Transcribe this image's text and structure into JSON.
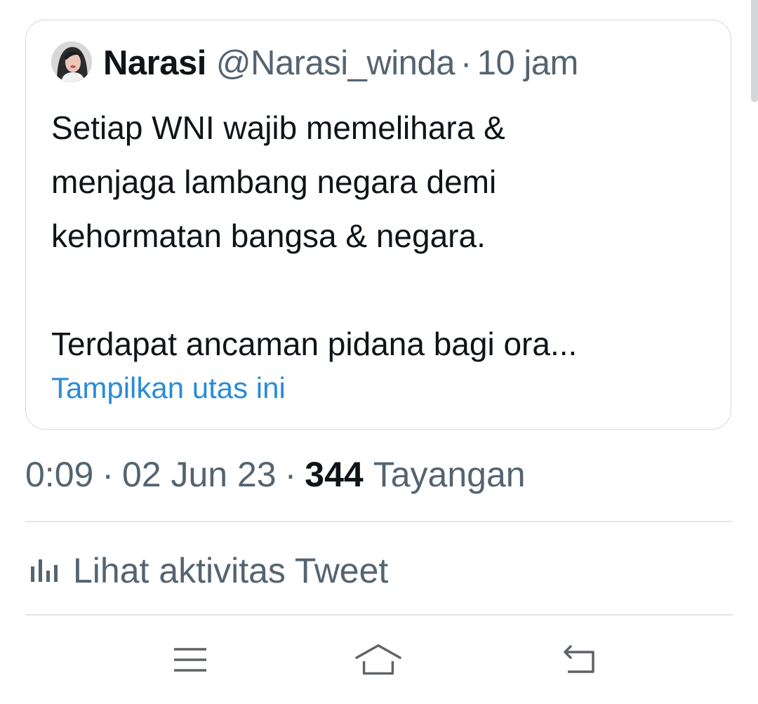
{
  "quoted_tweet": {
    "display_name": "Narasi",
    "handle": "@Narasi_winda",
    "separator": "·",
    "time_ago": "10 jam",
    "body_lines": [
      "Setiap WNI wajib memelihara &",
      "menjaga lambang negara demi",
      "kehormatan bangsa & negara."
    ],
    "body_truncated": "Terdapat ancaman pidana bagi ora...",
    "show_thread_label": "Tampilkan utas ini"
  },
  "tweet_meta": {
    "time": "0:09",
    "separator": "·",
    "date": "02 Jun 23",
    "views_count": "344",
    "views_label": "Tayangan"
  },
  "activity": {
    "icon": "bar-chart-icon",
    "label": "Lihat aktivitas Tweet"
  },
  "navbar": {
    "icons": [
      "menu-icon",
      "home-icon",
      "back-icon"
    ]
  },
  "colors": {
    "link": "#2a8bd6",
    "text_primary": "#0f1419",
    "text_secondary": "#536471",
    "border": "#cfd9de"
  }
}
